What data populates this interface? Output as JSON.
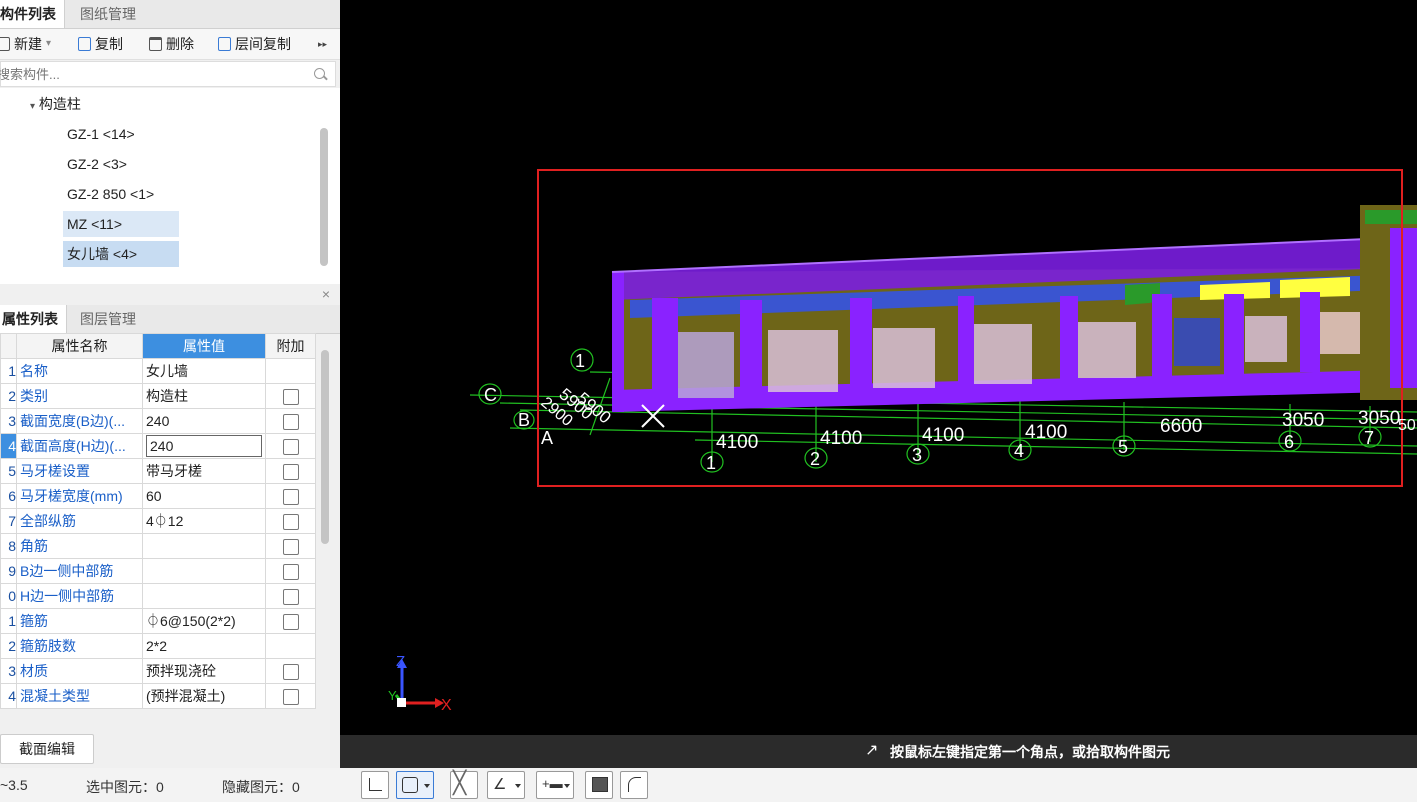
{
  "component_panel": {
    "tabs": [
      "构件列表",
      "图纸管理"
    ],
    "toolbar": {
      "new": "新建",
      "copy": "复制",
      "delete": "删除",
      "floor_copy": "层间复制",
      "more": "▸▸"
    },
    "search_placeholder": "搜索构件...",
    "tree": {
      "category": "构造柱",
      "items": [
        "GZ-1 <14>",
        "GZ-2 <3>",
        "GZ-2  850 <1>",
        "MZ <11>",
        "女儿墙 <4>"
      ]
    },
    "close": "×"
  },
  "property_panel": {
    "tabs": [
      "属性列表",
      "图层管理"
    ],
    "headers": [
      "属性名称",
      "属性值",
      "附加"
    ],
    "rows": [
      {
        "idx": "1",
        "name": "名称",
        "value": "女儿墙",
        "checkbox": false
      },
      {
        "idx": "2",
        "name": "类别",
        "value": "构造柱",
        "checkbox": true
      },
      {
        "idx": "3",
        "name": "截面宽度(B边)(...",
        "value": "240",
        "checkbox": true
      },
      {
        "idx": "4",
        "name": "截面高度(H边)(...",
        "value": "240",
        "checkbox": true
      },
      {
        "idx": "5",
        "name": "马牙槎设置",
        "value": "带马牙槎",
        "checkbox": true
      },
      {
        "idx": "6",
        "name": "马牙槎宽度(mm)",
        "value": "60",
        "checkbox": true
      },
      {
        "idx": "7",
        "name": "全部纵筋",
        "value": "4⏀12",
        "checkbox": true
      },
      {
        "idx": "8",
        "name": "角筋",
        "value": "",
        "checkbox": true
      },
      {
        "idx": "9",
        "name": "B边一侧中部筋",
        "value": "",
        "checkbox": true
      },
      {
        "idx": "0",
        "name": "H边一侧中部筋",
        "value": "",
        "checkbox": true
      },
      {
        "idx": "1",
        "name": "箍筋",
        "value": "⏀6@150(2*2)",
        "checkbox": true
      },
      {
        "idx": "2",
        "name": "箍筋肢数",
        "value": "2*2",
        "checkbox": false
      },
      {
        "idx": "3",
        "name": "材质",
        "value": "预拌现浇砼",
        "checkbox": true
      },
      {
        "idx": "4",
        "name": "混凝土类型",
        "value": "(预拌混凝土)",
        "checkbox": true
      }
    ],
    "section_edit_button": "截面编辑"
  },
  "viewport": {
    "axis_labels_rows": [
      "C",
      "B",
      "A",
      "1"
    ],
    "axis_labels_cols": [
      "1",
      "2",
      "3",
      "4",
      "5",
      "6",
      "7"
    ],
    "dimensions": [
      "4100",
      "4100",
      "4100",
      "4100",
      "6600",
      "3050",
      "3050",
      "5900",
      "2900",
      "5900"
    ],
    "dim_partial": "50",
    "axes": {
      "x": "X",
      "y": "Y",
      "z": "Z"
    }
  },
  "hint": "按鼠标左键指定第一个角点，或拾取构件图元",
  "status": {
    "elevation": "~3.5",
    "selected_label": "选中图元：0",
    "hidden_label": "隐藏图元：0"
  },
  "colors": {
    "accent": "#3d8fe0",
    "selection_box": "#e02020",
    "wall_purple": "#8a22ff",
    "wall_olive": "#7a7020",
    "grid_green": "#21c021"
  }
}
